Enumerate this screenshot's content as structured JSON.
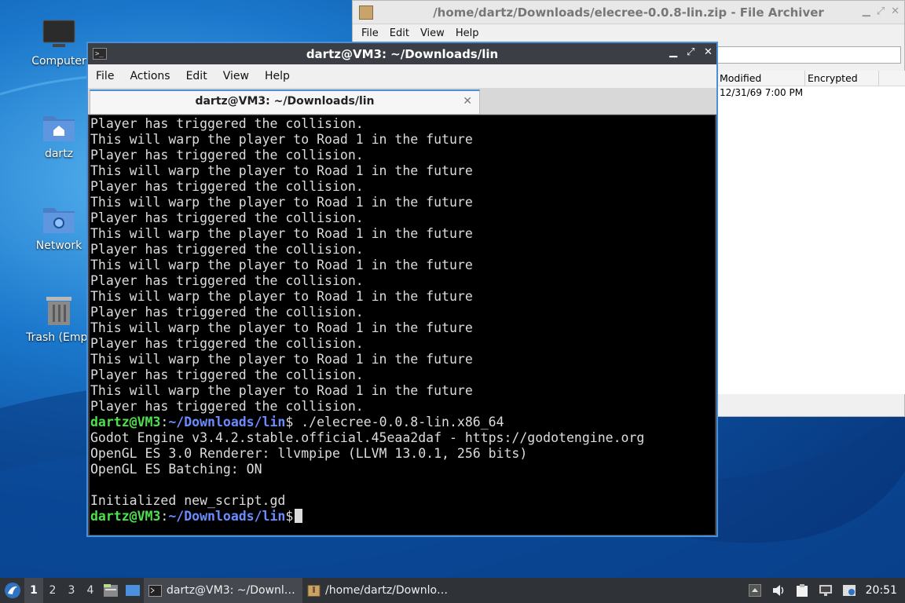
{
  "desktop": {
    "icons": [
      {
        "label": "Computer"
      },
      {
        "label": "dartz"
      },
      {
        "label": "Network"
      },
      {
        "label": "Trash (Empt"
      }
    ]
  },
  "archiver": {
    "title": "/home/dartz/Downloads/elecree-0.0.8-lin.zip - File Archiver",
    "menu": [
      "File",
      "Edit",
      "View",
      "Help"
    ],
    "columns": [
      "Modified",
      "Encrypted"
    ],
    "rows": [
      {
        "modified": "12/31/69 7:00 PM",
        "encrypted": ""
      }
    ]
  },
  "terminal": {
    "title": "dartz@VM3: ~/Downloads/lin",
    "menu": [
      "File",
      "Actions",
      "Edit",
      "View",
      "Help"
    ],
    "tab_label": "dartz@VM3: ~/Downloads/lin",
    "output_lines": [
      "Player has triggered the collision.",
      "This will warp the player to Road 1 in the future",
      "Player has triggered the collision.",
      "This will warp the player to Road 1 in the future",
      "Player has triggered the collision.",
      "This will warp the player to Road 1 in the future",
      "Player has triggered the collision.",
      "This will warp the player to Road 1 in the future",
      "Player has triggered the collision.",
      "This will warp the player to Road 1 in the future",
      "Player has triggered the collision.",
      "This will warp the player to Road 1 in the future",
      "Player has triggered the collision.",
      "This will warp the player to Road 1 in the future",
      "Player has triggered the collision.",
      "This will warp the player to Road 1 in the future",
      "Player has triggered the collision.",
      "This will warp the player to Road 1 in the future",
      "Player has triggered the collision."
    ],
    "prompt_user": "dartz@VM3",
    "prompt_sep": ":",
    "prompt_path": "~/Downloads/lin",
    "prompt_dollar": "$",
    "command": " ./elecree-0.0.8-lin.x86_64",
    "after_lines": [
      "Godot Engine v3.4.2.stable.official.45eaa2daf - https://godotengine.org",
      "OpenGL ES 3.0 Renderer: llvmpipe (LLVM 13.0.1, 256 bits)",
      "OpenGL ES Batching: ON",
      "",
      "Initialized new_script.gd"
    ]
  },
  "taskbar": {
    "workspaces": [
      "1",
      "2",
      "3",
      "4"
    ],
    "active_workspace": "1",
    "tasks": [
      {
        "label": "dartz@VM3: ~/Downl…"
      },
      {
        "label": "/home/dartz/Downlo…"
      }
    ],
    "clock": "20:51"
  }
}
